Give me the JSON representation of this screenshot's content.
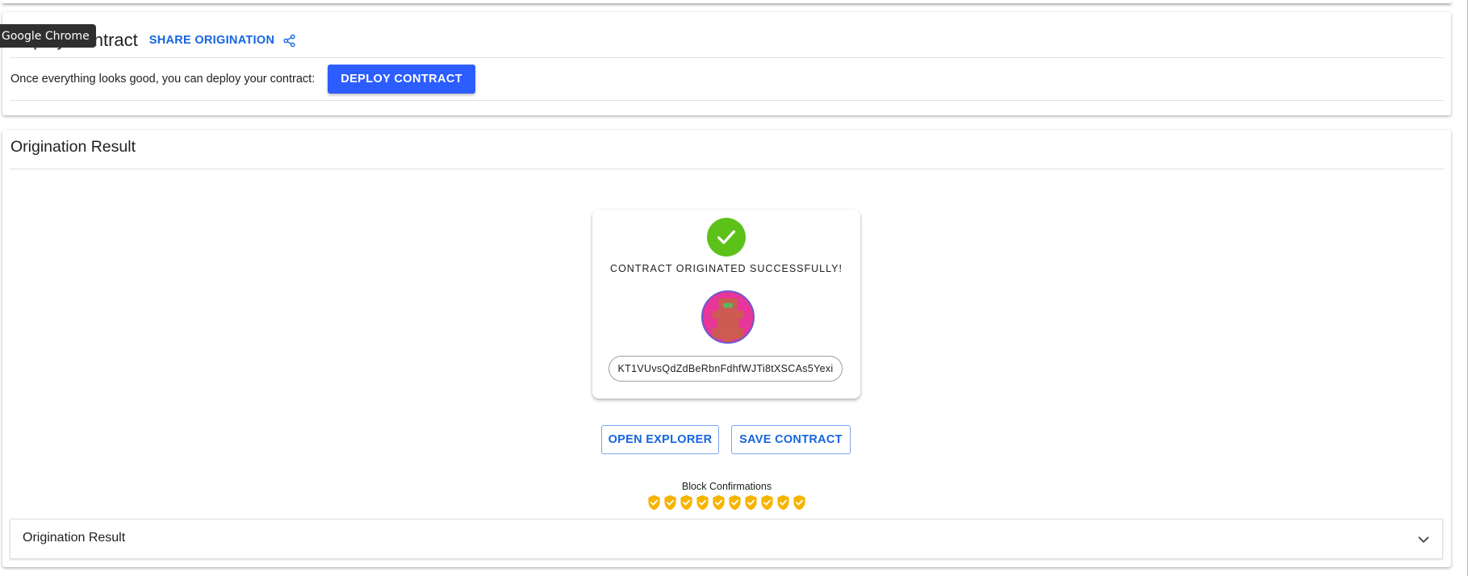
{
  "tooltip": {
    "text": "Google Chrome"
  },
  "deploy_section": {
    "title": "Deploy Contract",
    "share_label": "SHARE ORIGINATION",
    "share_icon": "share-icon",
    "instruction": "Once everything looks good, you can deploy your contract:",
    "deploy_button": "DEPLOY CONTRACT"
  },
  "result_section": {
    "title": "Origination Result",
    "success_icon": "check-circle-icon",
    "success_message": "CONTRACT ORIGINATED SUCCESSFULLY!",
    "avatar": "contract-identicon",
    "contract_address": "KT1VUvsQdZdBeRbnFdhfWJTi8tXSCAs5Yexi",
    "open_explorer_button": "OPEN EXPLORER",
    "save_contract_button": "SAVE CONTRACT",
    "confirmations_label": "Block Confirmations",
    "confirmations_count": 10,
    "confirmation_icon": "verified-shield-icon",
    "accordion_title": "Origination Result",
    "accordion_icon": "chevron-down-icon"
  },
  "colors": {
    "primary": "#2b5dff",
    "link": "#1565e0",
    "success": "#5cc119",
    "confirmation": "#f5b400"
  }
}
